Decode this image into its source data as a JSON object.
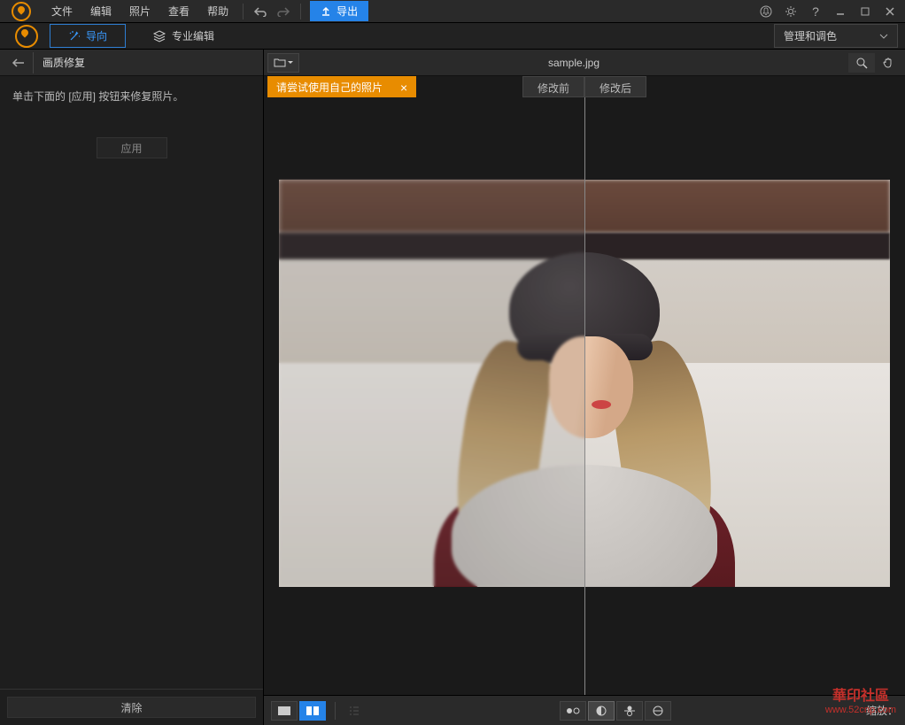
{
  "menu": {
    "file": "文件",
    "edit": "编辑",
    "photo": "照片",
    "view": "查看",
    "help": "帮助"
  },
  "toolbar": {
    "export": "导出"
  },
  "tabs": {
    "wizard": "导向",
    "pro": "专业编辑"
  },
  "mode_selector": {
    "label": "管理和调色"
  },
  "sidebar": {
    "title": "画质修复",
    "hint": "单击下面的 [应用] 按钮来修复照片。",
    "apply": "应用",
    "clear": "清除"
  },
  "viewer": {
    "filename": "sample.jpg",
    "tip": "请尝试使用自己的照片",
    "before": "修改前",
    "after": "修改后",
    "zoom_label": "缩放："
  },
  "watermark": {
    "title": "華印社區",
    "url": "www.52cnp.com"
  },
  "colors": {
    "accent": "#e88c00",
    "primary": "#2583e8",
    "bg": "#1a1a1a"
  }
}
